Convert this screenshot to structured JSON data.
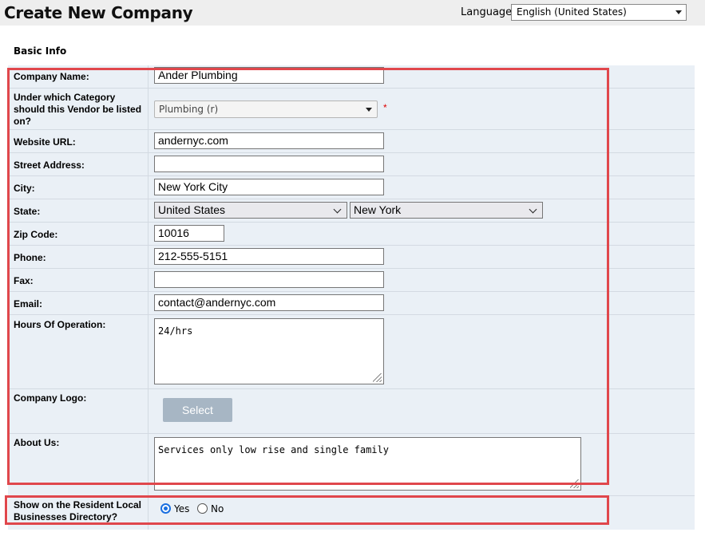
{
  "header": {
    "title": "Create New Company",
    "language_label": "Language:",
    "language_value": "English (United States)"
  },
  "section_title": "Basic Info",
  "fields": {
    "company_name": {
      "label": "Company Name:",
      "value": "Ander Plumbing"
    },
    "category": {
      "label": "Under which Category should this Vendor be listed on?",
      "value": "Plumbing (r)",
      "required_mark": "*"
    },
    "website": {
      "label": "Website URL:",
      "value": "andernyc.com"
    },
    "street": {
      "label": "Street Address:",
      "value": ""
    },
    "city": {
      "label": "City:",
      "value": "New York City"
    },
    "state": {
      "label": "State:",
      "country_value": "United States",
      "state_value": "New York"
    },
    "zip": {
      "label": "Zip Code:",
      "value": "10016"
    },
    "phone": {
      "label": "Phone:",
      "value": "212-555-5151"
    },
    "fax": {
      "label": "Fax:",
      "value": ""
    },
    "email": {
      "label": "Email:",
      "value": "contact@andernyc.com"
    },
    "hours": {
      "label": "Hours Of Operation:",
      "value": "24/hrs"
    },
    "logo": {
      "label": "Company Logo:",
      "button_label": "Select"
    },
    "about": {
      "label": "About Us:",
      "value": "Services only low rise and single family"
    },
    "directory": {
      "label": "Show on the Resident Local Businesses Directory?",
      "yes_label": "Yes",
      "no_label": "No",
      "selected": "Yes"
    }
  },
  "colors": {
    "highlight": "#e0474c",
    "form_background": "#eaf0f6",
    "radio_accent": "#1a6fe0",
    "select_button": "#a7b6c4"
  }
}
